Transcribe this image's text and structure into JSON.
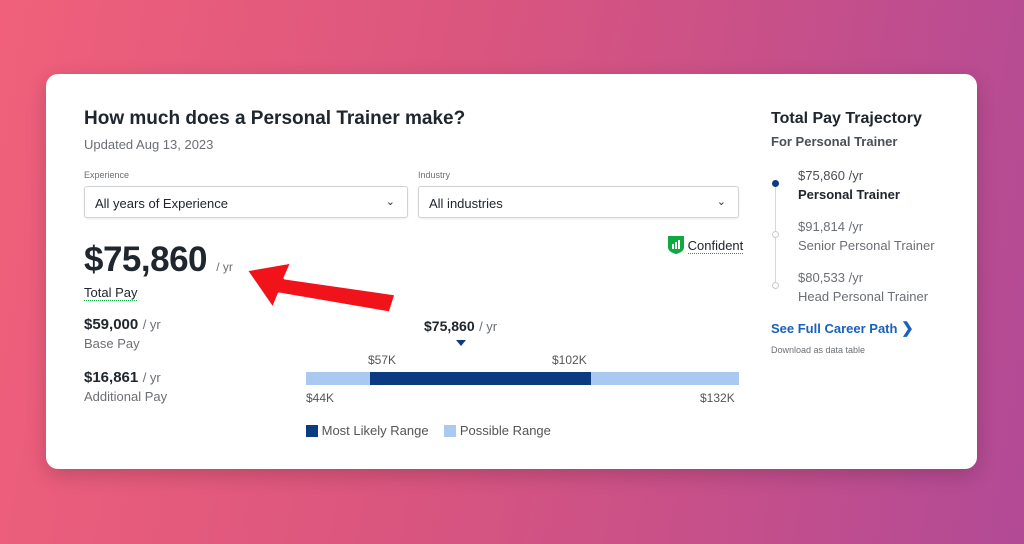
{
  "header": {
    "title": "How much does a Personal Trainer make?",
    "updated": "Updated Aug 13, 2023"
  },
  "filters": {
    "experience_label": "Experience",
    "experience_value": "All years of Experience",
    "industry_label": "Industry",
    "industry_value": "All industries"
  },
  "confidence": {
    "label": "Confident",
    "color": "#0caa41"
  },
  "total": {
    "amount": "$75,860",
    "unit": "/ yr",
    "label": "Total Pay"
  },
  "base": {
    "amount": "$59,000",
    "unit": "/ yr",
    "label": "Base Pay"
  },
  "additional": {
    "amount": "$16,861",
    "unit": "/ yr",
    "label": "Additional Pay"
  },
  "range": {
    "marker": "$75,860",
    "marker_unit": "/ yr",
    "likely_low": "$57K",
    "likely_high": "$102K",
    "min": "$44K",
    "max": "$132K",
    "legend_likely": "Most Likely Range",
    "legend_possible": "Possible Range",
    "likely_color": "#0d3b82",
    "possible_color": "#a9c9f0"
  },
  "trajectory": {
    "title": "Total Pay Trajectory",
    "subtitle": "For Personal Trainer",
    "items": [
      {
        "pay": "$75,860 /yr",
        "role": "Personal Trainer",
        "current": true
      },
      {
        "pay": "$91,814 /yr",
        "role": "Senior Personal Trainer",
        "current": false
      },
      {
        "pay": "$80,533 /yr",
        "role": "Head Personal Trainer",
        "current": false
      }
    ],
    "link": "See Full Career Path",
    "download": "Download as data table"
  }
}
